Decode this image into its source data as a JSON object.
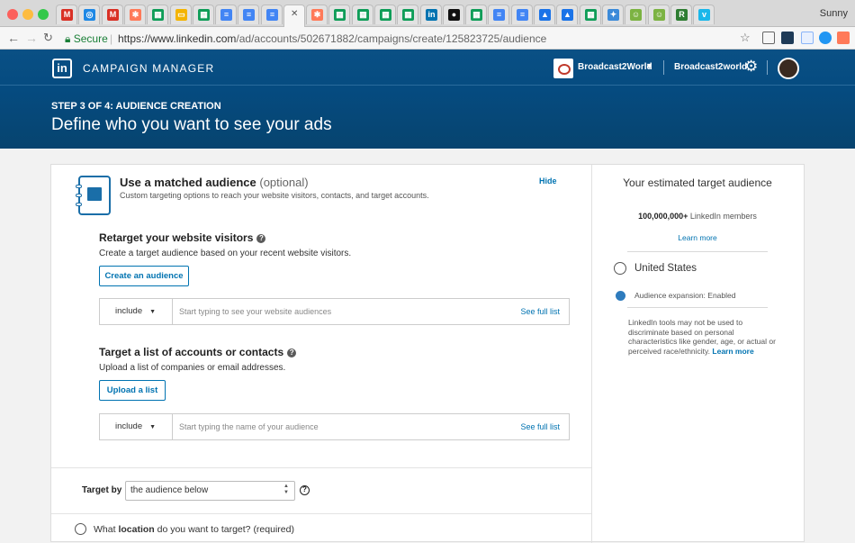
{
  "browser": {
    "profile_name": "Sunny",
    "secure_label": "Secure",
    "url_domain": "https://www.linkedin.com",
    "url_path": "/ad/accounts/502671882/campaigns/create/125823725/audience",
    "tab_close_glyph": "✕"
  },
  "tabs": [
    {
      "icon": "gmail-like-icon",
      "color": "#d93025",
      "glyph": "M"
    },
    {
      "icon": "target-icon",
      "color": "#1e88e5",
      "glyph": "◎"
    },
    {
      "icon": "gmail-icon",
      "color": "#d93025",
      "glyph": "M"
    },
    {
      "icon": "hubspot-icon",
      "color": "#ff7a59",
      "glyph": "✱"
    },
    {
      "icon": "sheets-icon",
      "color": "#0f9d58",
      "glyph": "▦"
    },
    {
      "icon": "slides-icon",
      "color": "#f4b400",
      "glyph": "▭"
    },
    {
      "icon": "sheets-icon",
      "color": "#0f9d58",
      "glyph": "▦"
    },
    {
      "icon": "docs-icon",
      "color": "#4285f4",
      "glyph": "≡"
    },
    {
      "icon": "docs-icon",
      "color": "#4285f4",
      "glyph": "≡"
    },
    {
      "icon": "docs-icon",
      "color": "#4285f4",
      "glyph": "≡"
    },
    {
      "icon": "hubspot-icon",
      "color": "#ff7a59",
      "glyph": "✱"
    },
    {
      "icon": "sheets-icon",
      "color": "#0f9d58",
      "glyph": "▦"
    },
    {
      "icon": "sheets-icon",
      "color": "#0f9d58",
      "glyph": "▦"
    },
    {
      "icon": "sheets-icon",
      "color": "#0f9d58",
      "glyph": "▦"
    },
    {
      "icon": "sheets-icon",
      "color": "#0f9d58",
      "glyph": "▦"
    },
    {
      "icon": "linkedin-icon",
      "color": "#0073b1",
      "glyph": "in"
    },
    {
      "icon": "dot-icon",
      "color": "#111111",
      "glyph": "●"
    },
    {
      "icon": "sheets-icon",
      "color": "#0f9d58",
      "glyph": "▦"
    },
    {
      "icon": "docs-icon",
      "color": "#4285f4",
      "glyph": "≡"
    },
    {
      "icon": "docs-icon",
      "color": "#4285f4",
      "glyph": "≡"
    },
    {
      "icon": "adwords-icon",
      "color": "#1a73e8",
      "glyph": "▲"
    },
    {
      "icon": "adwords-icon",
      "color": "#1a73e8",
      "glyph": "▲"
    },
    {
      "icon": "sheets-icon",
      "color": "#0f9d58",
      "glyph": "▦"
    },
    {
      "icon": "extension-icon",
      "color": "#3b8ad9",
      "glyph": "✦"
    },
    {
      "icon": "android-icon",
      "color": "#7cb342",
      "glyph": "☺"
    },
    {
      "icon": "android-icon",
      "color": "#7cb342",
      "glyph": "☺"
    },
    {
      "icon": "r-icon",
      "color": "#2e7d32",
      "glyph": "R"
    },
    {
      "icon": "vimeo-icon",
      "color": "#1ab7ea",
      "glyph": "v"
    }
  ],
  "colors": {
    "header_bg": "#054b80",
    "link_blue": "#0073b1",
    "page_bg": "#f2f2f2"
  },
  "header": {
    "logo_text": "in",
    "product_name": "CAMPAIGN MANAGER",
    "account_name": "Broadcast2World",
    "account_caret": "▼",
    "account_name_2": "Broadcast2world",
    "gear_glyph": "⚙"
  },
  "page": {
    "step": "STEP 3 OF 4: AUDIENCE CREATION",
    "heading": "Define who you want to see your ads"
  },
  "matched": {
    "title": "Use a matched audience",
    "optional": "(optional)",
    "subtitle": "Custom targeting options to reach your website visitors, contacts, and target accounts.",
    "hide_label": "Hide"
  },
  "retarget": {
    "title": "Retarget your website visitors",
    "help_glyph": "?",
    "description": "Create a target audience based on your recent website visitors.",
    "button": "Create an audience",
    "select_value": "include",
    "input_placeholder": "Start typing to see your website audiences",
    "see_full_list": "See full list"
  },
  "accounts": {
    "title": "Target a list of accounts or contacts",
    "help_glyph": "?",
    "description": "Upload a list of companies or email addresses.",
    "button": "Upload a list",
    "select_value": "include",
    "input_placeholder": "Start typing the name of your audience",
    "see_full_list": "See full list"
  },
  "target_by": {
    "label": "Target by",
    "value": "the audience below",
    "help_glyph": "?"
  },
  "location": {
    "prefix": "What ",
    "bold": "location",
    "suffix": " do you want to target? (required)"
  },
  "estimate": {
    "title": "Your estimated target audience",
    "count": "100,000,000+",
    "count_suffix": " LinkedIn members",
    "learn_more": "Learn more",
    "country": "United States",
    "expansion": "Audience expansion: Enabled",
    "disclaimer": "LinkedIn tools may not be used to discriminate based on personal characteristics like gender, age, or actual or perceived race/ethnicity.",
    "disclaimer_link": "Learn more"
  }
}
